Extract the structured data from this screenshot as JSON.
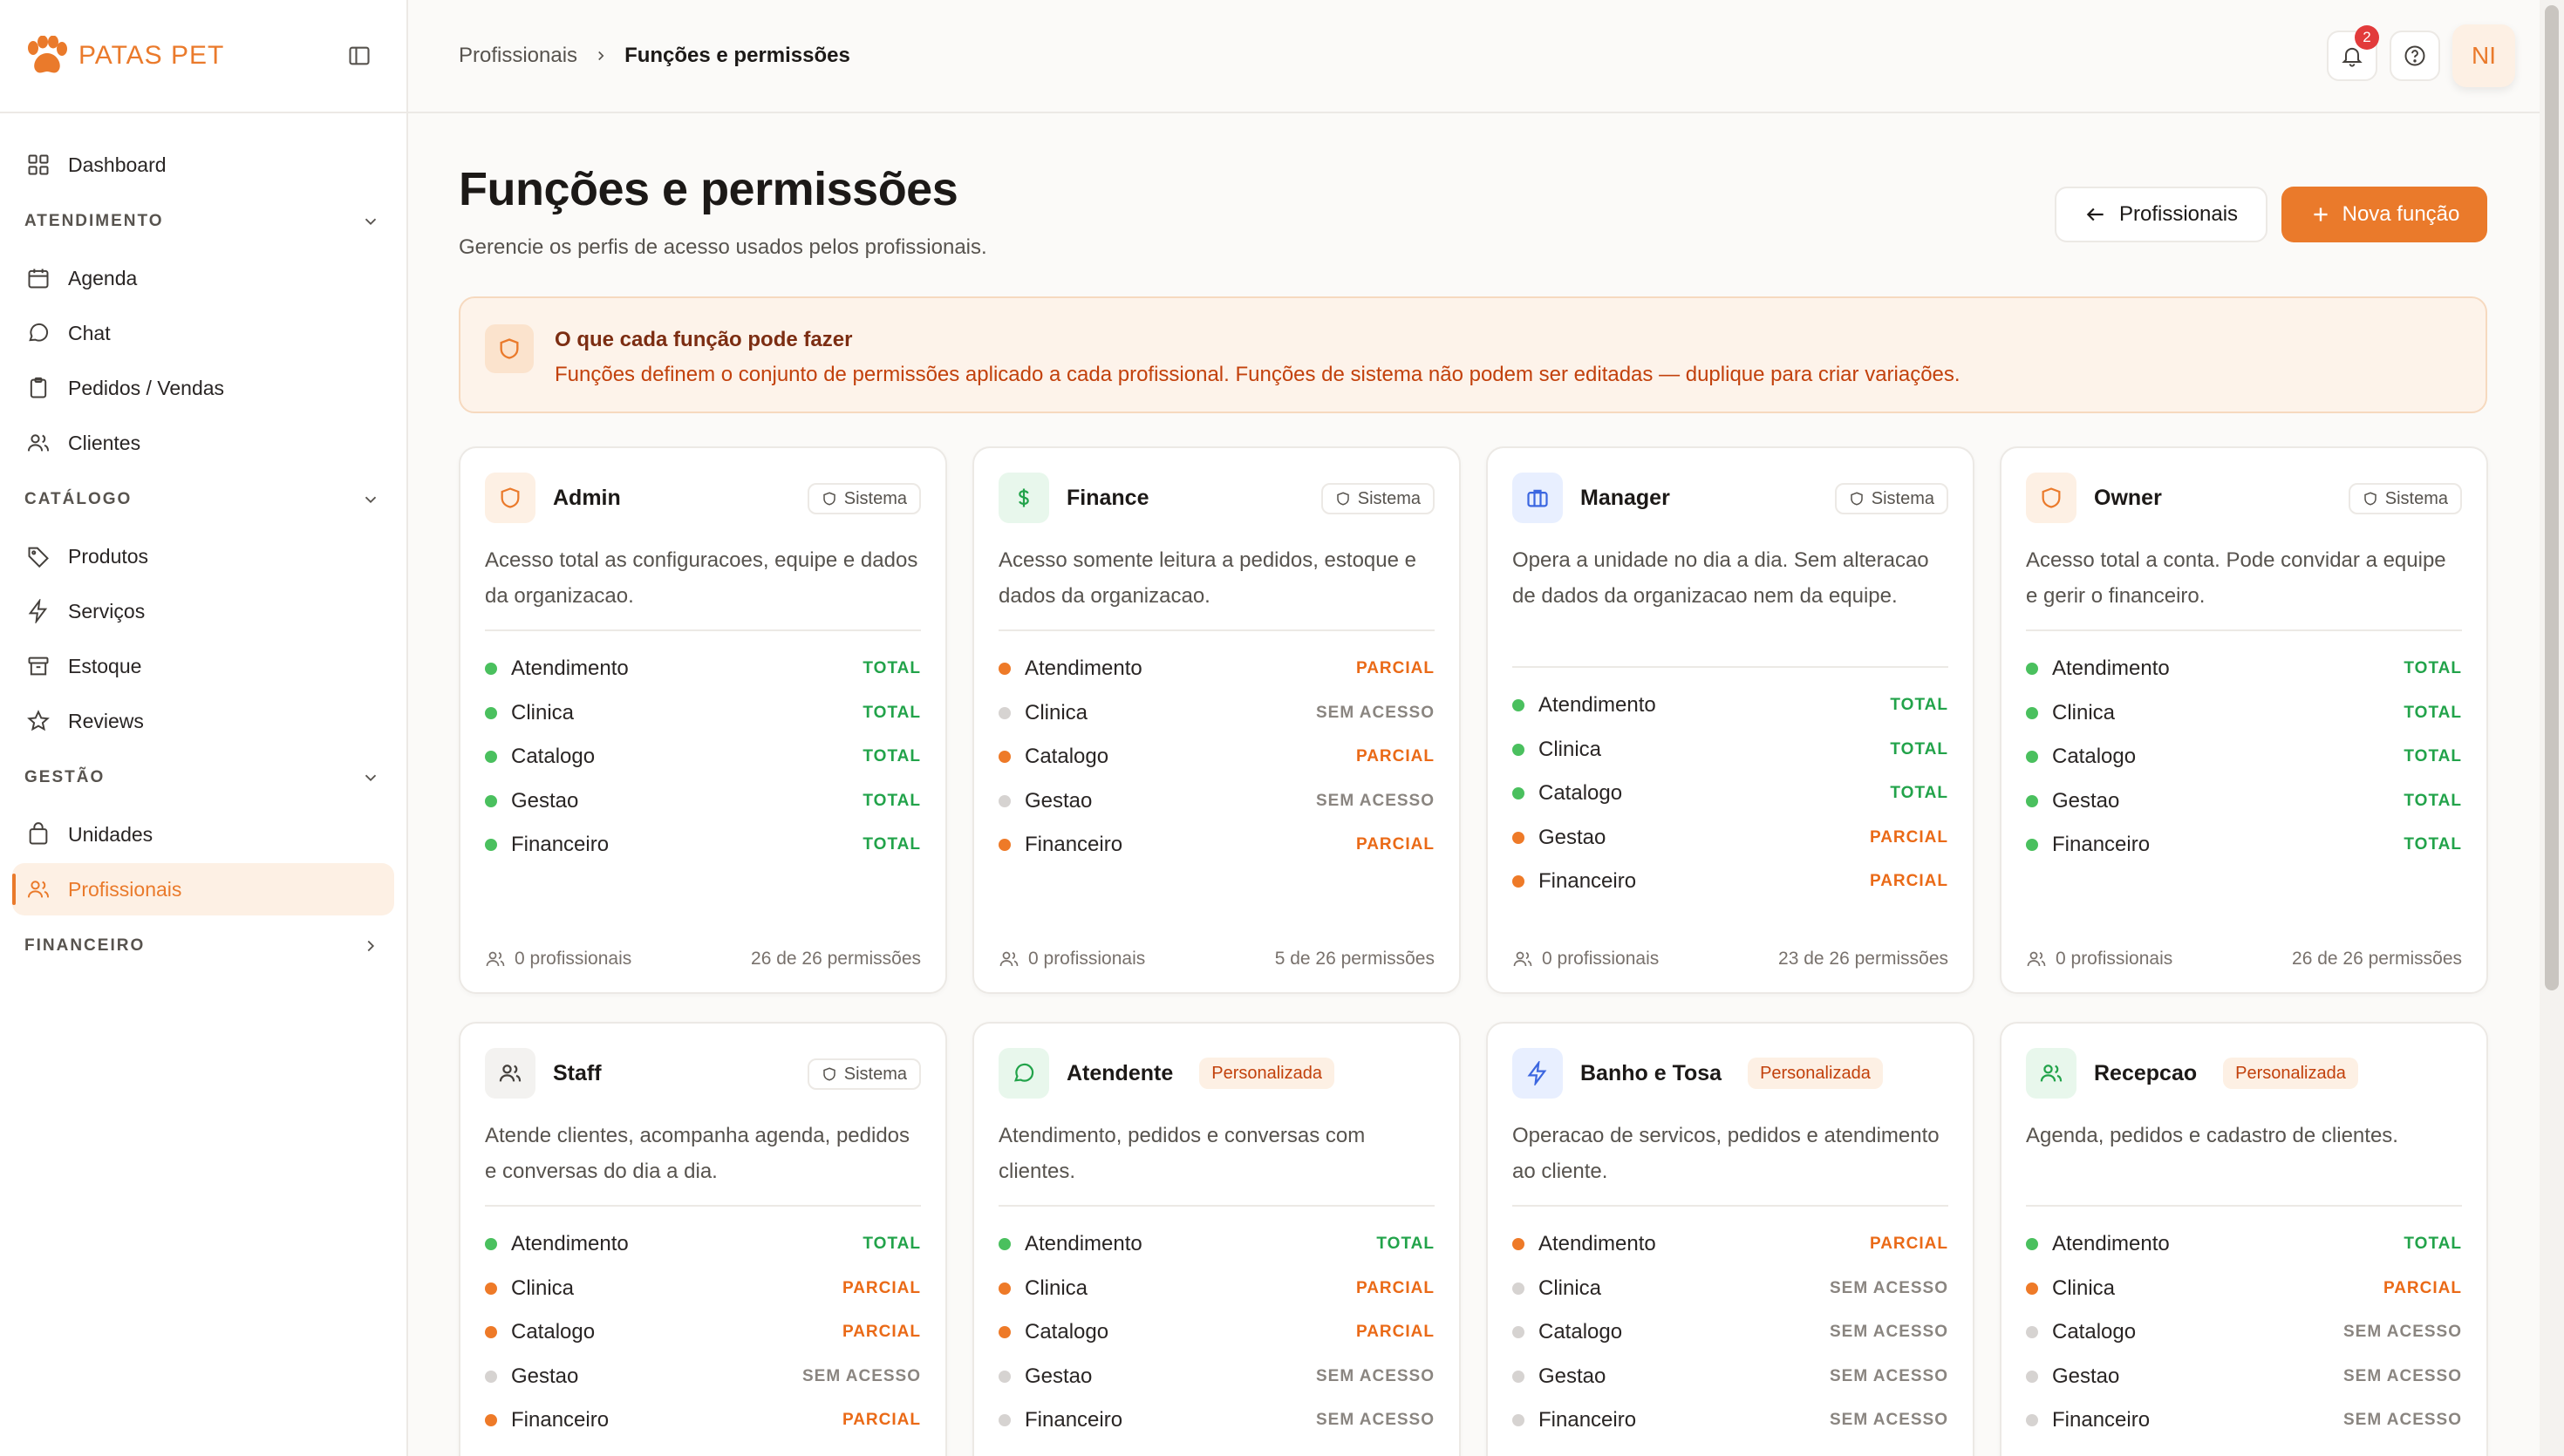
{
  "brand": {
    "name": "PATAS PET",
    "color": "#ea7a2b"
  },
  "sidebar": {
    "top_items": [
      {
        "label": "Dashboard",
        "icon": "grid-icon"
      }
    ],
    "sections": [
      {
        "label": "ATENDIMENTO",
        "chevron": "down",
        "items": [
          {
            "label": "Agenda",
            "icon": "calendar-icon"
          },
          {
            "label": "Chat",
            "icon": "chat-bubble-icon"
          },
          {
            "label": "Pedidos / Vendas",
            "icon": "clipboard-icon"
          },
          {
            "label": "Clientes",
            "icon": "users-icon"
          }
        ]
      },
      {
        "label": "CATÁLOGO",
        "chevron": "down",
        "items": [
          {
            "label": "Produtos",
            "icon": "tag-icon"
          },
          {
            "label": "Serviços",
            "icon": "lightning-icon"
          },
          {
            "label": "Estoque",
            "icon": "archive-box-icon"
          },
          {
            "label": "Reviews",
            "icon": "star-icon"
          }
        ]
      },
      {
        "label": "GESTÃO",
        "chevron": "down",
        "items": [
          {
            "label": "Unidades",
            "icon": "store-icon"
          },
          {
            "label": "Profissionais",
            "icon": "users-icon",
            "active": true
          }
        ]
      },
      {
        "label": "FINANCEIRO",
        "chevron": "right",
        "items": []
      }
    ]
  },
  "topbar": {
    "breadcrumb": [
      "Profissionais",
      "Funções e permissões"
    ],
    "notification_count": "2",
    "avatar_initials": "NI"
  },
  "main": {
    "title": "Funções e permissões",
    "subtitle": "Gerencie os perfis de acesso usados pelos profissionais.",
    "back_button": "Profissionais",
    "new_button": "Nova função",
    "info": {
      "title": "O que cada função pode fazer",
      "text": "Funções definem o conjunto de permissões aplicado a cada profissional. Funções de sistema não podem ser editadas — duplique para criar variações."
    }
  },
  "levels": {
    "TOTAL": {
      "label": "TOTAL",
      "color": "#22a34a",
      "dot": "#4ac05e"
    },
    "PARCIAL": {
      "label": "PARCIAL",
      "color": "#ea6a17",
      "dot": "#ee7a28"
    },
    "SEM ACESSO": {
      "label": "SEM ACESSO",
      "color": "#8a8580",
      "dot": "#d6d3d1"
    }
  },
  "roles": [
    {
      "name": "Admin",
      "tag": "Sistema",
      "tag_type": "system",
      "icon": "shield-icon",
      "icon_bg": "#fdf0e4",
      "icon_color": "#ea7a2b",
      "description": "Acesso total as configuracoes, equipe e dados da organizacao.",
      "permissions": [
        [
          "Atendimento",
          "TOTAL"
        ],
        [
          "Clinica",
          "TOTAL"
        ],
        [
          "Catalogo",
          "TOTAL"
        ],
        [
          "Gestao",
          "TOTAL"
        ],
        [
          "Financeiro",
          "TOTAL"
        ]
      ],
      "members": "0 profissionais",
      "perm_count": "26 de 26 permissões"
    },
    {
      "name": "Finance",
      "tag": "Sistema",
      "tag_type": "system",
      "icon": "dollar-icon",
      "icon_bg": "#e8f7ec",
      "icon_color": "#22a34a",
      "description": "Acesso somente leitura a pedidos, estoque e dados da organizacao.",
      "permissions": [
        [
          "Atendimento",
          "PARCIAL"
        ],
        [
          "Clinica",
          "SEM ACESSO"
        ],
        [
          "Catalogo",
          "PARCIAL"
        ],
        [
          "Gestao",
          "SEM ACESSO"
        ],
        [
          "Financeiro",
          "PARCIAL"
        ]
      ],
      "members": "0 profissionais",
      "perm_count": "5 de 26 permissões"
    },
    {
      "name": "Manager",
      "tag": "Sistema",
      "tag_type": "system",
      "icon": "briefcase-icon",
      "icon_bg": "#e8efff",
      "icon_color": "#3b66e0",
      "description": "Opera a unidade no dia a dia. Sem alteracao de dados da organizacao nem da equipe.",
      "permissions": [
        [
          "Atendimento",
          "TOTAL"
        ],
        [
          "Clinica",
          "TOTAL"
        ],
        [
          "Catalogo",
          "TOTAL"
        ],
        [
          "Gestao",
          "PARCIAL"
        ],
        [
          "Financeiro",
          "PARCIAL"
        ]
      ],
      "members": "0 profissionais",
      "perm_count": "23 de 26 permissões"
    },
    {
      "name": "Owner",
      "tag": "Sistema",
      "tag_type": "system",
      "icon": "shield-icon",
      "icon_bg": "#fdf0e4",
      "icon_color": "#ea7a2b",
      "description": "Acesso total a conta. Pode convidar a equipe e gerir o financeiro.",
      "permissions": [
        [
          "Atendimento",
          "TOTAL"
        ],
        [
          "Clinica",
          "TOTAL"
        ],
        [
          "Catalogo",
          "TOTAL"
        ],
        [
          "Gestao",
          "TOTAL"
        ],
        [
          "Financeiro",
          "TOTAL"
        ]
      ],
      "members": "0 profissionais",
      "perm_count": "26 de 26 permissões"
    },
    {
      "name": "Staff",
      "tag": "Sistema",
      "tag_type": "system",
      "icon": "users-icon",
      "icon_bg": "#f3f2f0",
      "icon_color": "#44403c",
      "description": "Atende clientes, acompanha agenda, pedidos e conversas do dia a dia.",
      "permissions": [
        [
          "Atendimento",
          "TOTAL"
        ],
        [
          "Clinica",
          "PARCIAL"
        ],
        [
          "Catalogo",
          "PARCIAL"
        ],
        [
          "Gestao",
          "SEM ACESSO"
        ],
        [
          "Financeiro",
          "PARCIAL"
        ]
      ],
      "members": "",
      "perm_count": ""
    },
    {
      "name": "Atendente",
      "tag": "Personalizada",
      "tag_type": "custom",
      "icon": "chat-bubble-icon",
      "icon_bg": "#e8f7ec",
      "icon_color": "#22a34a",
      "description": "Atendimento, pedidos e conversas com clientes.",
      "permissions": [
        [
          "Atendimento",
          "TOTAL"
        ],
        [
          "Clinica",
          "PARCIAL"
        ],
        [
          "Catalogo",
          "PARCIAL"
        ],
        [
          "Gestao",
          "SEM ACESSO"
        ],
        [
          "Financeiro",
          "SEM ACESSO"
        ]
      ],
      "members": "",
      "perm_count": ""
    },
    {
      "name": "Banho e Tosa",
      "tag": "Personalizada",
      "tag_type": "custom",
      "icon": "lightning-icon",
      "icon_bg": "#e8efff",
      "icon_color": "#3b66e0",
      "description": "Operacao de servicos, pedidos e atendimento ao cliente.",
      "permissions": [
        [
          "Atendimento",
          "PARCIAL"
        ],
        [
          "Clinica",
          "SEM ACESSO"
        ],
        [
          "Catalogo",
          "SEM ACESSO"
        ],
        [
          "Gestao",
          "SEM ACESSO"
        ],
        [
          "Financeiro",
          "SEM ACESSO"
        ]
      ],
      "members": "",
      "perm_count": ""
    },
    {
      "name": "Recepcao",
      "tag": "Personalizada",
      "tag_type": "custom",
      "icon": "users-icon",
      "icon_bg": "#e8f7ec",
      "icon_color": "#22a34a",
      "description": "Agenda, pedidos e cadastro de clientes.",
      "permissions": [
        [
          "Atendimento",
          "TOTAL"
        ],
        [
          "Clinica",
          "PARCIAL"
        ],
        [
          "Catalogo",
          "SEM ACESSO"
        ],
        [
          "Gestao",
          "SEM ACESSO"
        ],
        [
          "Financeiro",
          "SEM ACESSO"
        ]
      ],
      "members": "",
      "perm_count": ""
    }
  ]
}
